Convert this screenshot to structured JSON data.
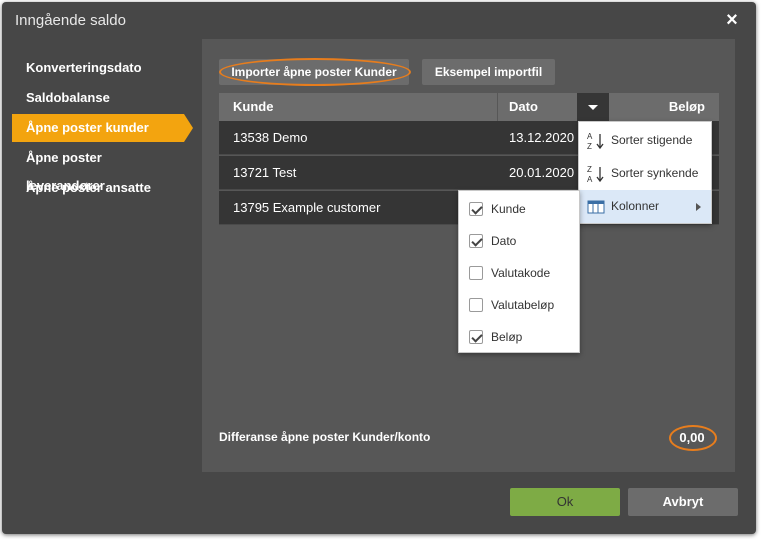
{
  "dialog": {
    "title": "Inngående saldo",
    "close_icon": "×"
  },
  "sidebar": {
    "items": [
      {
        "label": "Konverteringsdato",
        "active": false
      },
      {
        "label": "Saldobalanse",
        "active": false
      },
      {
        "label": "Åpne poster kunder",
        "active": true
      },
      {
        "label": "Åpne poster leverandører",
        "active": false
      },
      {
        "label": "Åpne poster ansatte",
        "active": false
      }
    ]
  },
  "toolbar": {
    "import_label": "Importer åpne poster Kunder",
    "example_label": "Eksempel importfil"
  },
  "grid": {
    "columns": [
      "Kunde",
      "Dato",
      "Beløp"
    ],
    "rows": [
      {
        "kunde": "13538 Demo",
        "dato": "13.12.2020"
      },
      {
        "kunde": "13721 Test",
        "dato": "20.01.2020"
      },
      {
        "kunde": "13795 Example customer",
        "dato": ""
      }
    ]
  },
  "column_menu": {
    "sort_asc": "Sorter stigende",
    "sort_desc": "Sorter synkende",
    "columns": "Kolonner",
    "sort_asc_icon": "A↓Z",
    "sort_desc_icon": "Z↓A"
  },
  "columns_submenu": [
    {
      "label": "Kunde",
      "checked": true
    },
    {
      "label": "Dato",
      "checked": true
    },
    {
      "label": "Valutakode",
      "checked": false
    },
    {
      "label": "Valutabeløp",
      "checked": false
    },
    {
      "label": "Beløp",
      "checked": true
    }
  ],
  "summary": {
    "label": "Differanse åpne poster Kunder/konto",
    "value": "0,00"
  },
  "footer": {
    "ok_label": "Ok",
    "cancel_label": "Avbryt"
  },
  "colors": {
    "dialog_bg": "#474747",
    "panel_bg": "#575757",
    "accent": "#f3a40f",
    "highlight_ring": "#e77d1d",
    "ok_green": "#7eab45",
    "row_bg": "#353535"
  }
}
